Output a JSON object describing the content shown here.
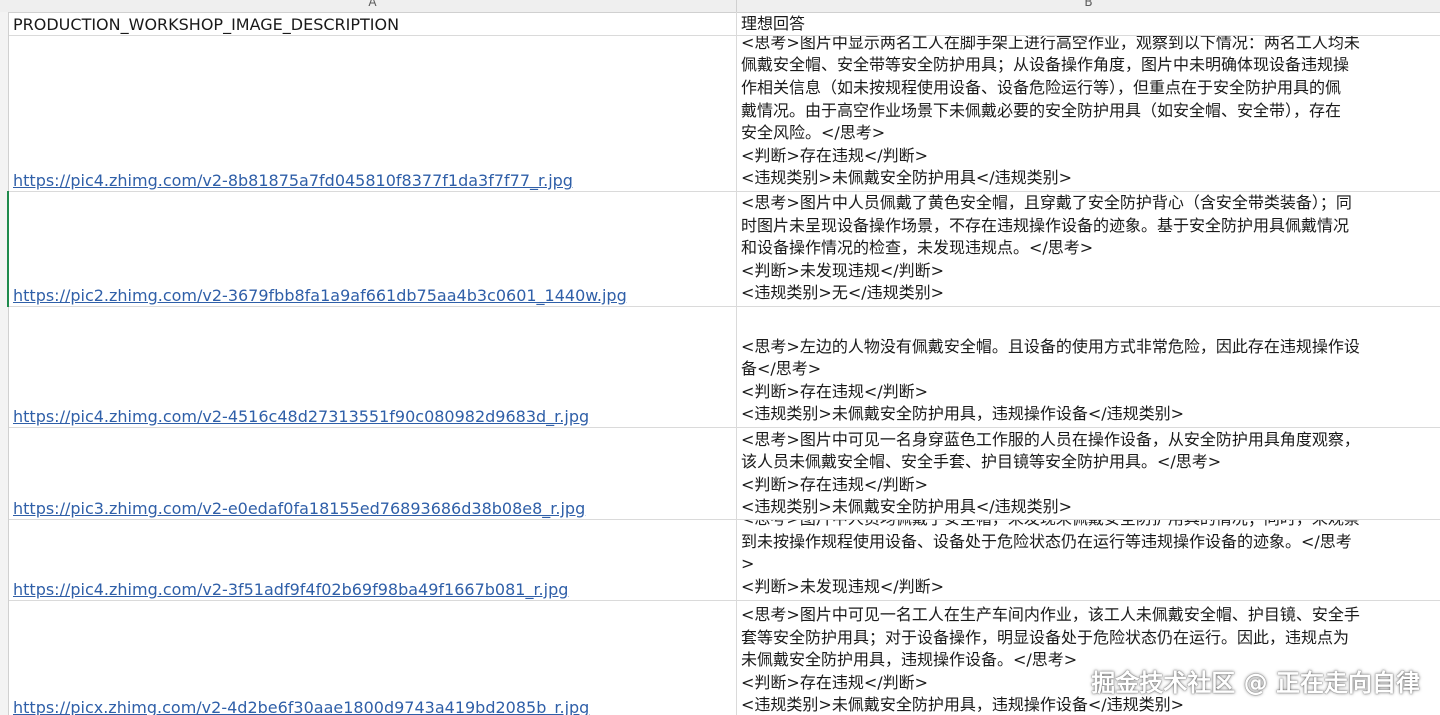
{
  "columns": {
    "a": "A",
    "b": "B"
  },
  "header": {
    "a": "PRODUCTION_WORKSHOP_IMAGE_DESCRIPTION",
    "b": "理想回答"
  },
  "rows": [
    {
      "url": "https://pic4.zhimg.com/v2-8b81875a7fd045810f8377f1da3f7f77_r.jpg",
      "lines": [
        "<思考>图片中显示两名工人在脚手架上进行高空作业，观察到以下情况：两名工人均未",
        "佩戴安全帽、安全带等安全防护用具；从设备操作角度，图片中未明确体现设备违规操",
        "作相关信息（如未按规程使用设备、设备危险运行等），但重点在于安全防护用具的佩",
        "戴情况。由于高空作业场景下未佩戴必要的安全防护用具（如安全帽、安全带），存在",
        "安全风险。</思考>",
        "<判断>存在违规</判断>",
        "<违规类别>未佩戴安全防护用具</违规类别>"
      ]
    },
    {
      "url": "https://pic2.zhimg.com/v2-3679fbb8fa1a9af661db75aa4b3c0601_1440w.jpg",
      "lines": [
        "<思考>图片中人员佩戴了黄色安全帽，且穿戴了安全防护背心（含安全带类装备）；同",
        "时图片未呈现设备操作场景，不存在违规操作设备的迹象。基于安全防护用具佩戴情况",
        "和设备操作情况的检查，未发现违规点。</思考>",
        "<判断>未发现违规</判断>",
        "<违规类别>无</违规类别>"
      ]
    },
    {
      "url": "https://pic4.zhimg.com/v2-4516c48d27313551f90c080982d9683d_r.jpg",
      "lines": [
        "<思考>左边的人物没有佩戴安全帽。且设备的使用方式非常危险，因此存在违规操作设",
        "备</思考>",
        "<判断>存在违规</判断>",
        "<违规类别>未佩戴安全防护用具，违规操作设备</违规类别>"
      ]
    },
    {
      "url": "https://pic3.zhimg.com/v2-e0edaf0fa18155ed76893686d38b08e8_r.jpg",
      "lines": [
        "<思考>图片中可见一名身穿蓝色工作服的人员在操作设备，从安全防护用具角度观察，",
        "该人员未佩戴安全帽、安全手套、护目镜等安全防护用具。</思考>",
        "<判断>存在违规</判断>",
        "<违规类别>未佩戴安全防护用具</违规类别>"
      ]
    },
    {
      "url": "https://pic4.zhimg.com/v2-3f51adf9f4f02b69f98ba49f1667b081_r.jpg",
      "lines": [
        "<思考>图片中人员均佩戴了安全帽，未发现未佩戴安全防护用具的情况；同时，未观察",
        "到未按操作规程使用设备、设备处于危险状态仍在运行等违规操作设备的迹象。</思考",
        ">",
        "<判断>未发现违规</判断>"
      ]
    },
    {
      "url": "https://picx.zhimg.com/v2-4d2be6f30aae1800d9743a419bd2085b_r.jpg",
      "lines": [
        "<思考>图片中可见一名工人在生产车间内作业，该工人未佩戴安全帽、护目镜、安全手",
        "套等安全防护用具；对于设备操作，明显设备处于危险状态仍在运行。因此，违规点为",
        "未佩戴安全防护用具，违规操作设备。</思考>",
        "<判断>存在违规</判断>",
        "<违规类别>未佩戴安全防护用具，违规操作设备</违规类别>"
      ]
    }
  ],
  "watermark": "掘金技术社区 @ 正在走向自律"
}
